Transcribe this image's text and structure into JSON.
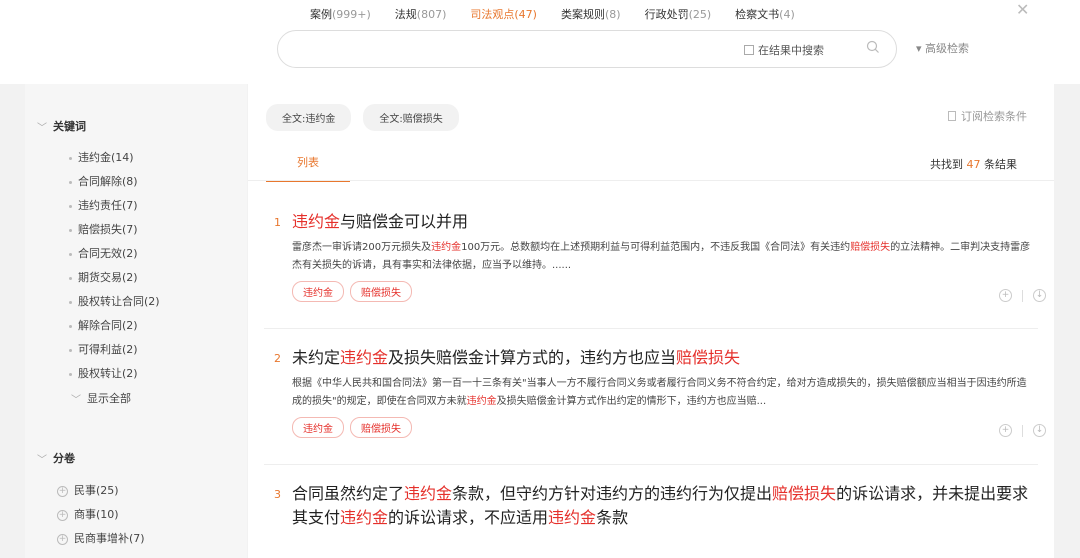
{
  "tabs": [
    {
      "label": "案例",
      "count": "(999+)",
      "active": false
    },
    {
      "label": "法规",
      "count": "(807)",
      "active": false
    },
    {
      "label": "司法观点",
      "count": "(47)",
      "active": true
    },
    {
      "label": "类案规则",
      "count": "(8)",
      "active": false
    },
    {
      "label": "行政处罚",
      "count": "(25)",
      "active": false
    },
    {
      "label": "检察文书",
      "count": "(4)",
      "active": false
    }
  ],
  "search": {
    "value": "",
    "placeholder": "",
    "in_results_label": "在结果中搜索",
    "advanced_label": "▾ 高级检索"
  },
  "sidebar": {
    "keywords_title": "关键词",
    "keywords": [
      "违约金(14)",
      "合同解除(8)",
      "违约责任(7)",
      "赔偿损失(7)",
      "合同无效(2)",
      "期货交易(2)",
      "股权转让合同(2)",
      "解除合同(2)",
      "可得利益(2)",
      "股权转让(2)"
    ],
    "show_all": "显示全部",
    "volume_title": "分卷",
    "volumes": [
      "民事(25)",
      "商事(10)",
      "民商事增补(7)"
    ]
  },
  "main": {
    "chips": [
      "全文:违约金",
      "全文:赔偿损失"
    ],
    "subscribe_label": "订阅检索条件",
    "list_tab": "列表",
    "count_prefix": "共找到",
    "count_num": "47",
    "count_suffix": "条结果"
  },
  "results": [
    {
      "index": "1",
      "title": [
        {
          "t": "违约金",
          "hl": true
        },
        {
          "t": "与赔偿金可以并用",
          "hl": false
        }
      ],
      "summary": [
        {
          "t": "雷彦杰一审诉请200万元损失及",
          "hl": false
        },
        {
          "t": "违约金",
          "hl": true
        },
        {
          "t": "100万元。总数额均在上述预期利益与可得利益范围内，不违反我国《合同法》有关违约",
          "hl": false
        },
        {
          "t": "赔偿损失",
          "hl": true
        },
        {
          "t": "的立法精神。二审判决支持雷彦杰有关损失的诉请，具有事实和法律依据，应当予以维持。......",
          "hl": false
        }
      ],
      "tags": [
        "违约金",
        "赔偿损失"
      ]
    },
    {
      "index": "2",
      "title": [
        {
          "t": "未约定",
          "hl": false
        },
        {
          "t": "违约金",
          "hl": true
        },
        {
          "t": "及损失赔偿金计算方式的，违约方也应当",
          "hl": false
        },
        {
          "t": "赔偿损失",
          "hl": true
        }
      ],
      "summary": [
        {
          "t": "根据《中华人民共和国合同法》第一百一十三条有关\"当事人一方不履行合同义务或者履行合同义务不符合约定，给对方造成损失的，损失赔偿额应当相当于因违约所造成的损失\"的规定，即使在合同双方未就",
          "hl": false
        },
        {
          "t": "违约金",
          "hl": true
        },
        {
          "t": "及损失赔偿金计算方式作出约定的情形下，违约方也应当赔...",
          "hl": false
        }
      ],
      "tags": [
        "违约金",
        "赔偿损失"
      ]
    },
    {
      "index": "3",
      "title": [
        {
          "t": "合同虽然约定了",
          "hl": false
        },
        {
          "t": "违约金",
          "hl": true
        },
        {
          "t": "条款，但守约方针对违约方的违约行为仅提出",
          "hl": false
        },
        {
          "t": "赔偿损失",
          "hl": true
        },
        {
          "t": "的诉讼请求，并未提出要求其支付",
          "hl": false
        },
        {
          "t": "违约金",
          "hl": true
        },
        {
          "t": "的诉讼请求，不应适用",
          "hl": false
        },
        {
          "t": "违约金",
          "hl": true
        },
        {
          "t": "条款",
          "hl": false
        }
      ],
      "summary": [],
      "tags": []
    }
  ]
}
